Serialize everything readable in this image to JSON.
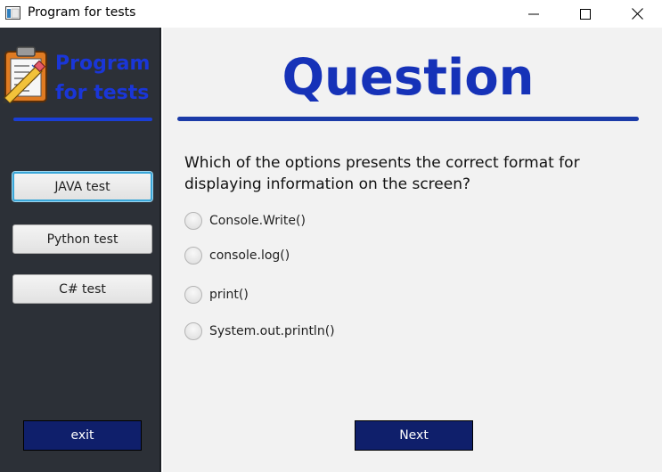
{
  "window": {
    "title": "Program for tests"
  },
  "sidebar": {
    "logo_line1": "Program",
    "logo_line2": "for tests",
    "tests": [
      {
        "label": "JAVA test"
      },
      {
        "label": "Python test"
      },
      {
        "label": "C# test"
      }
    ],
    "exit_label": "exit"
  },
  "main": {
    "heading": "Question",
    "question": "Which of the options presents the correct format for displaying information on the screen?",
    "options": [
      {
        "label": "Console.Write()",
        "selected": false
      },
      {
        "label": "console.log()",
        "selected": false
      },
      {
        "label": "print()",
        "selected": false
      },
      {
        "label": "System.out.println()",
        "selected": false
      }
    ],
    "next_label": "Next"
  },
  "colors": {
    "sidebar_bg": "#2c3037",
    "main_bg": "#f2f2f2",
    "accent_blue": "#1632b8",
    "dark_button": "#0f1f6b",
    "focus_ring": "#3aa7d9"
  },
  "icons": {
    "app": "window-app-icon",
    "logo": "clipboard-checklist-pencil-icon",
    "minimize": "minimize-icon",
    "maximize": "maximize-icon",
    "close": "close-icon"
  }
}
